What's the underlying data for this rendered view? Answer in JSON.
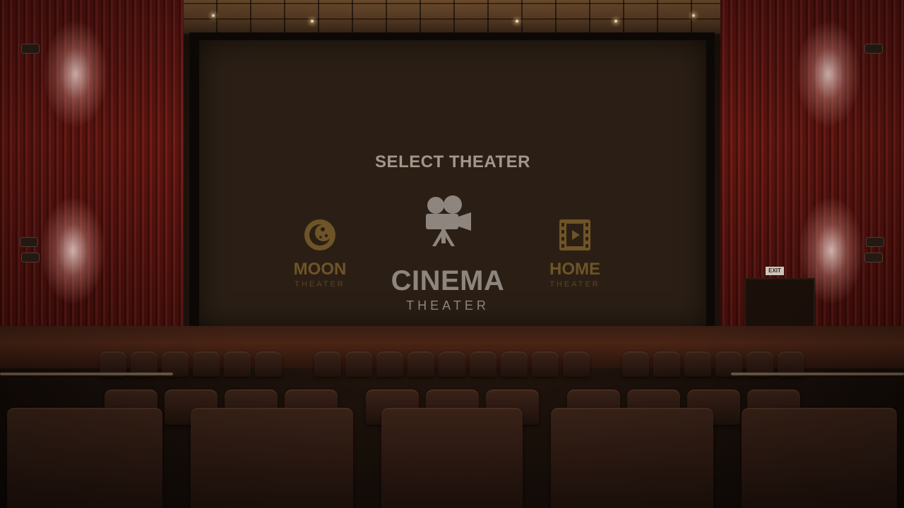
{
  "menu": {
    "title": "SELECT THEATER",
    "options": [
      {
        "name": "MOON",
        "sub": "THEATER",
        "icon": "moon-icon",
        "state": "inactive"
      },
      {
        "name": "CINEMA",
        "sub": "THEATER",
        "icon": "film-camera-icon",
        "state": "selected"
      },
      {
        "name": "HOME",
        "sub": "THEATER",
        "icon": "film-strip-play-icon",
        "state": "inactive"
      }
    ]
  },
  "scene": {
    "exit_sign": "EXIT"
  },
  "colors": {
    "screen": "#2b1f15",
    "title_text": "#a3978a",
    "selected_option": "#8d857e",
    "inactive_option": "#6e5427",
    "curtain": "#5a1410"
  }
}
